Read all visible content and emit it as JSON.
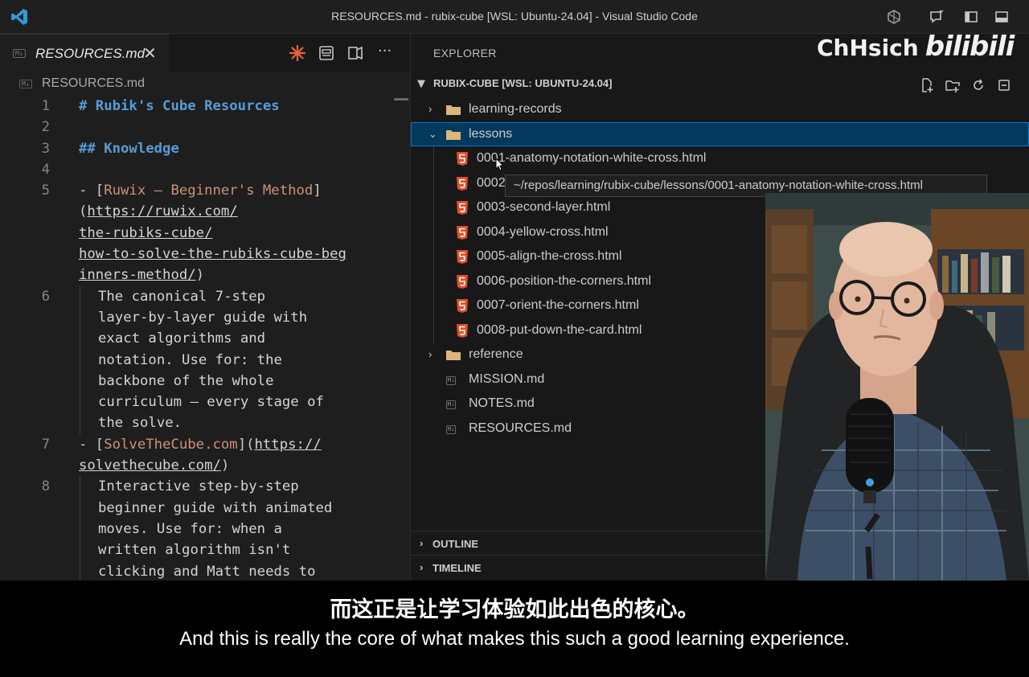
{
  "window": {
    "title": "RESOURCES.md - rubix-cube [WSL: Ubuntu-24.04] - Visual Studio Code"
  },
  "watermark": {
    "name": "ChHsich",
    "site": "bilibili"
  },
  "editor": {
    "tab": {
      "badge": "M↓",
      "label": "RESOURCES.md",
      "close": "✕",
      "more": "···"
    },
    "breadcrumb": {
      "badge": "M↓",
      "label": "RESOURCES.md"
    },
    "lines": [
      {
        "num": "1",
        "parts": [
          {
            "c": "h",
            "t": "# Rubik's Cube Resources"
          }
        ]
      },
      {
        "num": "2",
        "parts": []
      },
      {
        "num": "3",
        "parts": [
          {
            "c": "h",
            "t": "## Knowledge"
          }
        ]
      },
      {
        "num": "4",
        "parts": []
      },
      {
        "num": "5",
        "parts": [
          {
            "c": "punc",
            "t": "- ["
          },
          {
            "c": "lt",
            "t": "Ruwix — Beginner's Method"
          },
          {
            "c": "punc",
            "t": "]"
          }
        ]
      },
      {
        "num": "",
        "parts": [
          {
            "c": "punc",
            "t": "("
          },
          {
            "c": "url",
            "t": "https://ruwix.com/"
          }
        ]
      },
      {
        "num": "",
        "parts": [
          {
            "c": "url",
            "t": "the-rubiks-cube/"
          }
        ]
      },
      {
        "num": "",
        "parts": [
          {
            "c": "url",
            "t": "how-to-solve-the-rubiks-cube-beg"
          }
        ]
      },
      {
        "num": "",
        "parts": [
          {
            "c": "url",
            "t": "inners-method/"
          },
          {
            "c": "punc",
            "t": ")"
          }
        ]
      },
      {
        "num": "6",
        "indent": true,
        "parts": [
          {
            "c": "txt",
            "t": "The canonical 7-step"
          }
        ]
      },
      {
        "num": "",
        "indent": true,
        "parts": [
          {
            "c": "txt",
            "t": "layer-by-layer guide with"
          }
        ]
      },
      {
        "num": "",
        "indent": true,
        "parts": [
          {
            "c": "txt",
            "t": "exact algorithms and"
          }
        ]
      },
      {
        "num": "",
        "indent": true,
        "parts": [
          {
            "c": "txt",
            "t": "notation. Use for: the"
          }
        ]
      },
      {
        "num": "",
        "indent": true,
        "parts": [
          {
            "c": "txt",
            "t": "backbone of the whole"
          }
        ]
      },
      {
        "num": "",
        "indent": true,
        "parts": [
          {
            "c": "txt",
            "t": "curriculum — every stage of"
          }
        ]
      },
      {
        "num": "",
        "indent": true,
        "parts": [
          {
            "c": "txt",
            "t": "the solve."
          }
        ]
      },
      {
        "num": "7",
        "parts": [
          {
            "c": "punc",
            "t": "- ["
          },
          {
            "c": "lt",
            "t": "SolveTheCube.com"
          },
          {
            "c": "punc",
            "t": "]("
          },
          {
            "c": "url",
            "t": "https://"
          }
        ]
      },
      {
        "num": "",
        "parts": [
          {
            "c": "url",
            "t": "solvethecube.com/"
          },
          {
            "c": "punc",
            "t": ")"
          }
        ]
      },
      {
        "num": "8",
        "indent": true,
        "parts": [
          {
            "c": "txt",
            "t": "Interactive step-by-step"
          }
        ]
      },
      {
        "num": "",
        "indent": true,
        "parts": [
          {
            "c": "txt",
            "t": "beginner guide with animated"
          }
        ]
      },
      {
        "num": "",
        "indent": true,
        "parts": [
          {
            "c": "txt",
            "t": "moves. Use for: when a"
          }
        ]
      },
      {
        "num": "",
        "indent": true,
        "parts": [
          {
            "c": "txt",
            "t": "written algorithm isn't"
          }
        ]
      },
      {
        "num": "",
        "indent": true,
        "parts": [
          {
            "c": "txt",
            "t": "clicking and Matt needs to"
          }
        ]
      }
    ]
  },
  "explorer": {
    "header": "EXPLORER",
    "section": "RUBIX-CUBE [WSL: UBUNTU-24.04]",
    "tree": [
      {
        "kind": "folder",
        "open": false,
        "label": "learning-records"
      },
      {
        "kind": "folder",
        "open": true,
        "label": "lessons",
        "selected": true
      },
      {
        "kind": "html",
        "label": "0001-anatomy-notation-white-cross.html"
      },
      {
        "kind": "html",
        "label": "0002"
      },
      {
        "kind": "html",
        "label": "0003-second-layer.html"
      },
      {
        "kind": "html",
        "label": "0004-yellow-cross.html"
      },
      {
        "kind": "html",
        "label": "0005-align-the-cross.html"
      },
      {
        "kind": "html",
        "label": "0006-position-the-corners.html"
      },
      {
        "kind": "html",
        "label": "0007-orient-the-corners.html"
      },
      {
        "kind": "html",
        "label": "0008-put-down-the-card.html"
      },
      {
        "kind": "folder",
        "open": false,
        "label": "reference"
      },
      {
        "kind": "md",
        "label": "MISSION.md"
      },
      {
        "kind": "md",
        "label": "NOTES.md"
      },
      {
        "kind": "md",
        "label": "RESOURCES.md"
      }
    ],
    "tooltip": "~/repos/learning/rubix-cube/lessons/0001-anatomy-notation-white-cross.html",
    "outline": "OUTLINE",
    "timeline": "TIMELINE"
  },
  "subtitles": {
    "zh": "而这正是让学习体验如此出色的核心。",
    "en": "And this is really the core of what makes this such a good learning experience."
  },
  "colors": {
    "accent": "#0078d4",
    "heading": "#569cd6",
    "linkText": "#ce9178",
    "html5": "#e44d26",
    "folder": "#dcb67a"
  }
}
